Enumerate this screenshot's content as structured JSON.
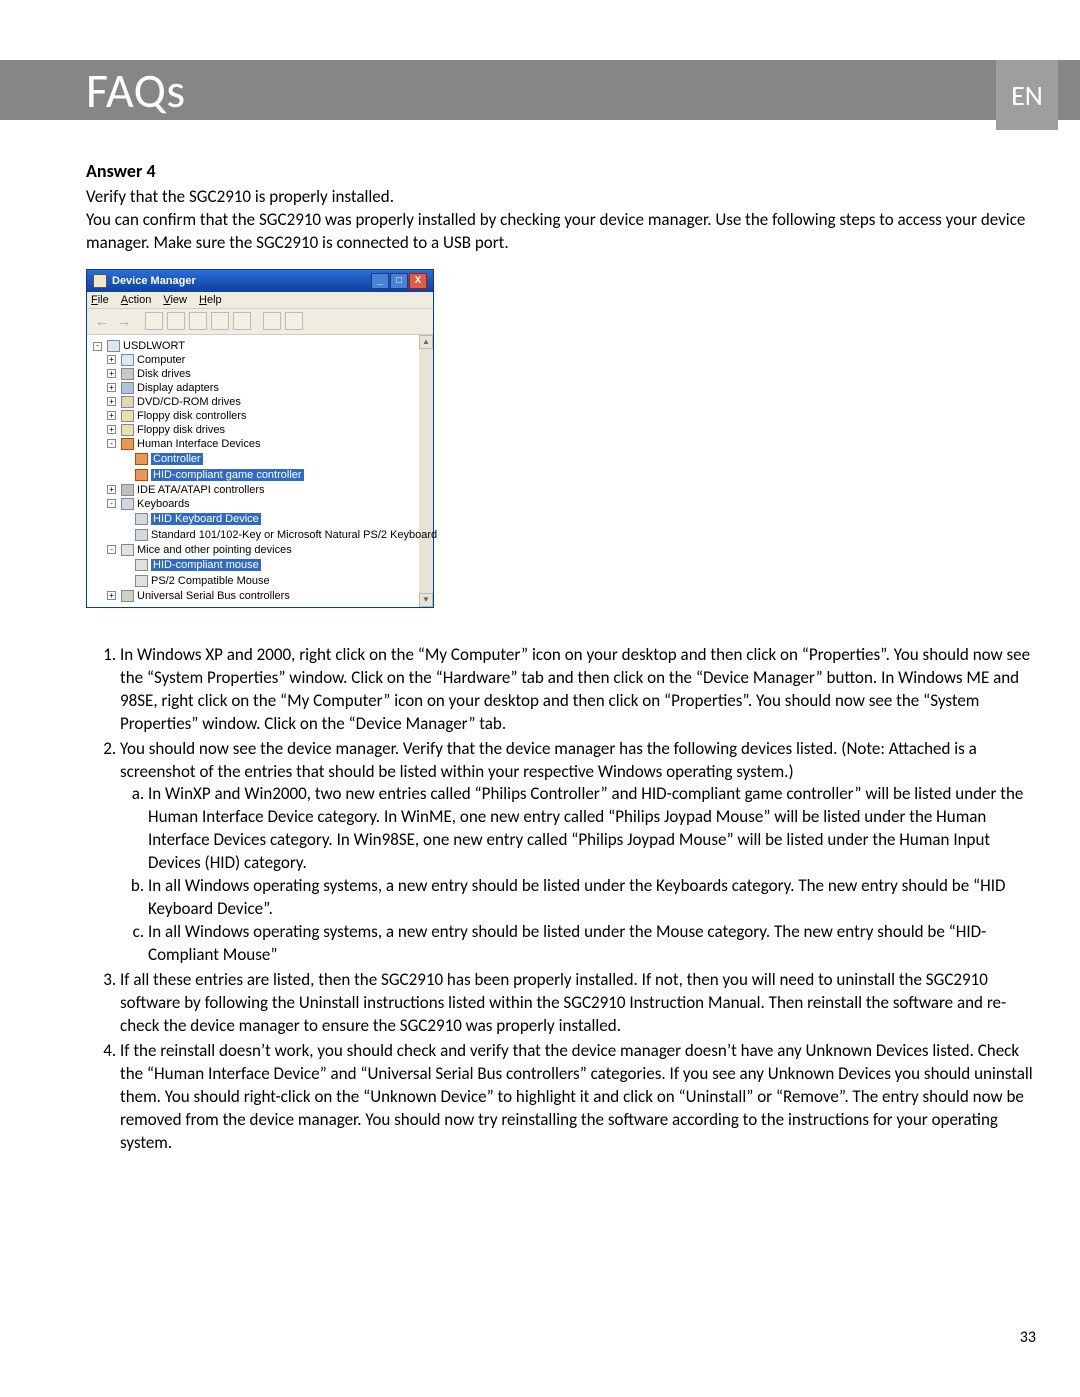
{
  "header": {
    "title": "FAQs",
    "lang": "EN"
  },
  "answer": {
    "heading": "Answer 4",
    "intro1": "Verify that the SGC2910 is properly installed.",
    "intro2": "You can confirm that the SGC2910 was properly installed by checking your device manager. Use the following steps to access your device manager. Make sure the SGC2910 is connected to a USB port."
  },
  "dm": {
    "title": "Device Manager",
    "menu": {
      "file": "File",
      "action": "Action",
      "view": "View",
      "help": "Help"
    },
    "root": "USDLWORT",
    "nodes": {
      "computer": "Computer",
      "disk": "Disk drives",
      "display": "Display adapters",
      "dvd": "DVD/CD-ROM drives",
      "floppyctrl": "Floppy disk controllers",
      "floppy": "Floppy disk drives",
      "hid": "Human Interface Devices",
      "controller": "Controller",
      "hidgame": "HID-compliant game controller",
      "ide": "IDE ATA/ATAPI controllers",
      "keyboards": "Keyboards",
      "hidkbd": "HID Keyboard Device",
      "stdkbd": "Standard 101/102-Key or Microsoft Natural PS/2 Keyboard",
      "mice": "Mice and other pointing devices",
      "hidmouse": "HID-compliant mouse",
      "ps2mouse": "PS/2 Compatible Mouse",
      "usb": "Universal Serial Bus controllers"
    }
  },
  "steps": {
    "s1": "In Windows XP and 2000, right click on the “My Computer” icon on your desktop and then click on “Properties”. You should now see the “System Properties” window. Click on the “Hardware” tab and then click on the “Device Manager” button. In Windows ME and 98SE, right click on the “My Computer” icon on your desktop and then click on “Properties”. You should now see the “System Properties” window. Click on the “Device Manager” tab.",
    "s2": "You should now see the device manager. Verify that the device manager has the following devices listed. (Note: Attached is a screenshot of the entries that should be listed within your respective Windows operating system.)",
    "s2a": "In WinXP and Win2000, two new entries called “Philips Controller” and HID-compliant game controller” will be listed under the Human Interface Device category. In WinME, one new entry called “Philips Joypad Mouse” will be listed under the Human Interface Devices category. In Win98SE, one new entry called “Philips Joypad Mouse” will be listed under the Human Input Devices (HID) category.",
    "s2b": "In all Windows operating systems, a new entry should be listed under the Keyboards category. The new entry should be “HID Keyboard Device”.",
    "s2c": "In all Windows operating systems, a new entry should be listed under the Mouse category. The new entry should be “HID-Compliant Mouse”",
    "s3": "If all these entries are listed, then the SGC2910 has been properly installed. If not, then you will need to uninstall the SGC2910 software by following the Uninstall instructions listed within the SGC2910 Instruction Manual. Then reinstall the software and re-check the device manager to ensure the SGC2910 was properly installed.",
    "s4": "If the reinstall doesn’t work, you should check and verify that the device manager doesn’t have any Unknown Devices listed. Check the “Human Interface Device” and “Universal Serial Bus controllers” categories. If you see any Unknown Devices you should uninstall them. You should right-click on the “Unknown Device” to highlight it and click on “Uninstall” or “Remove”. The entry should now be removed from the device manager. You should now try reinstalling the software according to the instructions for your operating system."
  },
  "page_number": "33"
}
